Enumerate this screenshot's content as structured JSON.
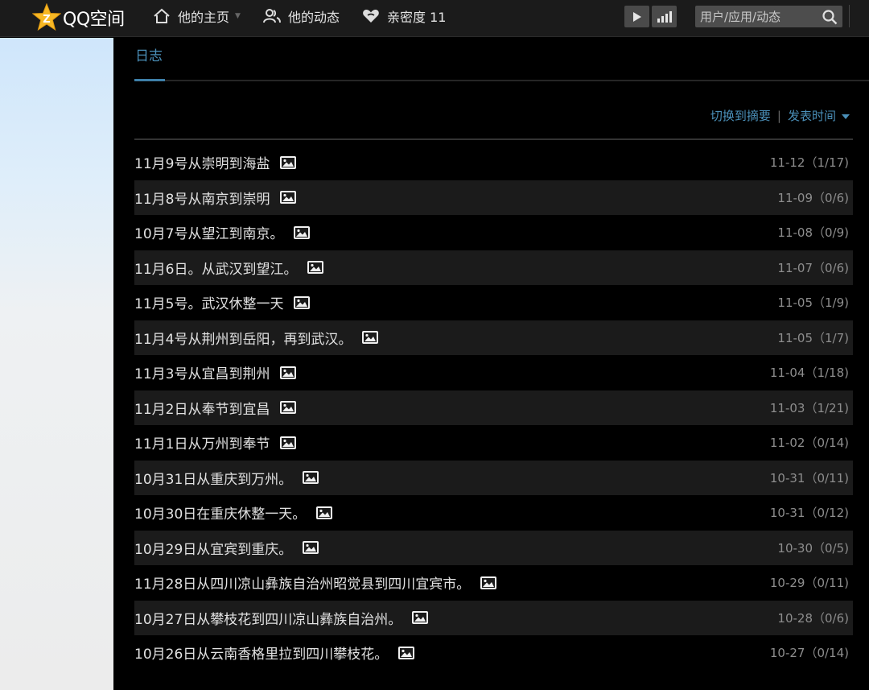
{
  "topbar": {
    "logo_text": "QQ空间",
    "nav": [
      {
        "label": "他的主页",
        "icon": "home-icon"
      },
      {
        "label": "他的动态",
        "icon": "users-icon"
      },
      {
        "label": "亲密度 11",
        "icon": "heart-icon"
      }
    ],
    "search_placeholder": "用户/应用/动态"
  },
  "colors": {
    "accent": "#4a8fb8",
    "row_alt_bg": "#1b1b1b",
    "topbar_bg": "#1b1b1b"
  },
  "main": {
    "tab_label": "日志",
    "toolbar": {
      "switch_label": "切换到摘要",
      "separator": "|",
      "sort_label": "发表时间"
    }
  },
  "entries": [
    {
      "title": "11月9号从崇明到海盐",
      "meta": "11-12（1/17)"
    },
    {
      "title": "11月8号从南京到崇明",
      "meta": "11-09（0/6)"
    },
    {
      "title": "10月7号从望江到南京。",
      "meta": "11-08（0/9)"
    },
    {
      "title": "11月6日。从武汉到望江。",
      "meta": "11-07（0/6)"
    },
    {
      "title": "11月5号。武汉休整一天",
      "meta": "11-05（1/9)"
    },
    {
      "title": "11月4号从荆州到岳阳，再到武汉。",
      "meta": "11-05（1/7)"
    },
    {
      "title": "11月3号从宜昌到荆州",
      "meta": "11-04（1/18)"
    },
    {
      "title": "11月2日从奉节到宜昌",
      "meta": "11-03（1/21)"
    },
    {
      "title": "11月1日从万州到奉节",
      "meta": "11-02（0/14)"
    },
    {
      "title": "10月31日从重庆到万州。",
      "meta": "10-31（0/11)"
    },
    {
      "title": "10月30日在重庆休整一天。",
      "meta": "10-31（0/12)"
    },
    {
      "title": "10月29日从宜宾到重庆。",
      "meta": "10-30（0/5)"
    },
    {
      "title": "11月28日从四川凉山彝族自治州昭觉县到四川宜宾市。",
      "meta": "10-29（0/11)"
    },
    {
      "title": "10月27日从攀枝花到四川凉山彝族自治州。",
      "meta": "10-28（0/6)"
    },
    {
      "title": "10月26日从云南香格里拉到四川攀枝花。",
      "meta": "10-27（0/14)"
    }
  ]
}
